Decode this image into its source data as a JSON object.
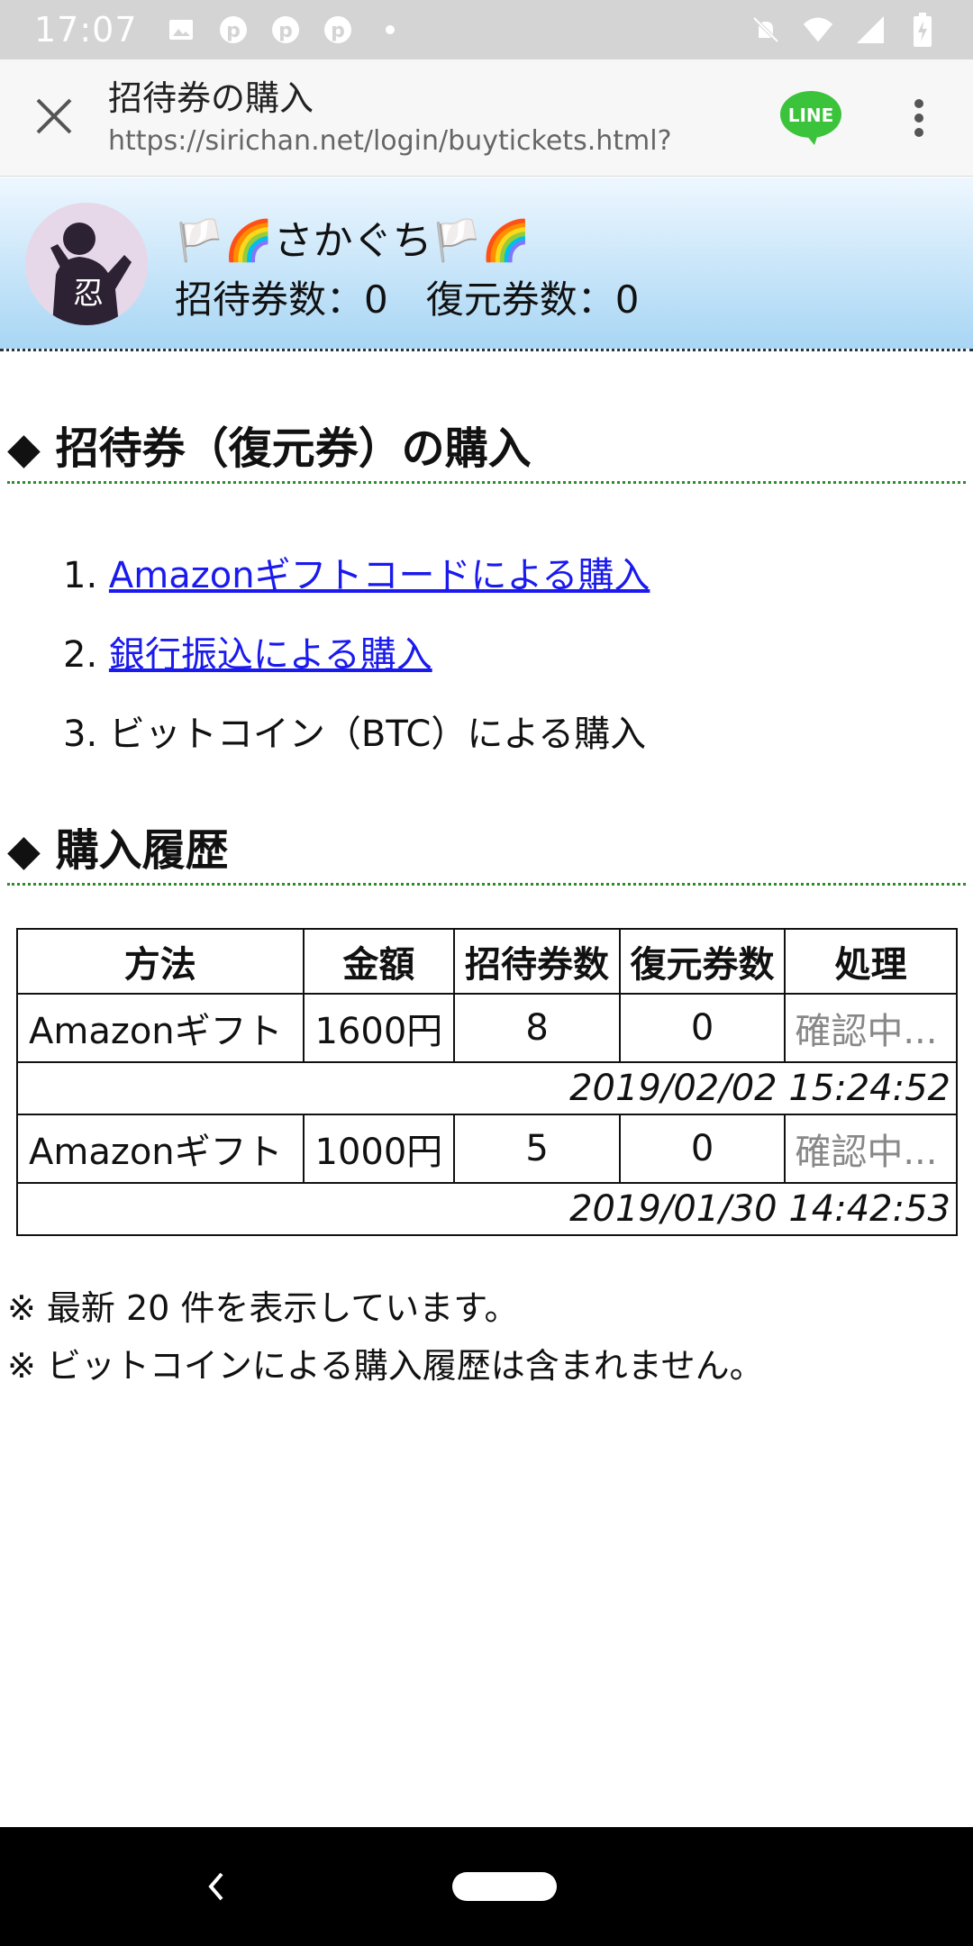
{
  "status_bar": {
    "time": "17:07"
  },
  "browser": {
    "title": "招待券の購入",
    "url": "https://sirichan.net/login/buytickets.html?",
    "line_label": "LINE"
  },
  "profile": {
    "name": "🏳️🌈さかぐち🏳️🌈",
    "counts": "招待券数：0　復元券数：0",
    "avatar_char": "忍"
  },
  "sections": {
    "purchase_heading": "◆ 招待券（復元券）の購入",
    "history_heading": "◆ 購入履歴"
  },
  "purchase_options": [
    {
      "num": "1.",
      "label": "Amazonギフトコードによる購入"
    },
    {
      "num": "2.",
      "label": "銀行振込による購入"
    },
    {
      "num": "3.",
      "label": "ビットコイン（BTC）による購入"
    }
  ],
  "history": {
    "headers": [
      "方法",
      "金額",
      "招待券数",
      "復元券数",
      "処理"
    ],
    "rows": [
      {
        "method": "Amazonギフト",
        "amount": "1600円",
        "invites": "8",
        "restores": "0",
        "status": "確認中...",
        "timestamp": "2019/02/02 15:24:52"
      },
      {
        "method": "Amazonギフト",
        "amount": "1000円",
        "invites": "5",
        "restores": "0",
        "status": "確認中...",
        "timestamp": "2019/01/30 14:42:53"
      }
    ]
  },
  "notes": [
    "※ 最新 20 件を表示しています。",
    "※ ビットコインによる購入履歴は含まれません。"
  ]
}
